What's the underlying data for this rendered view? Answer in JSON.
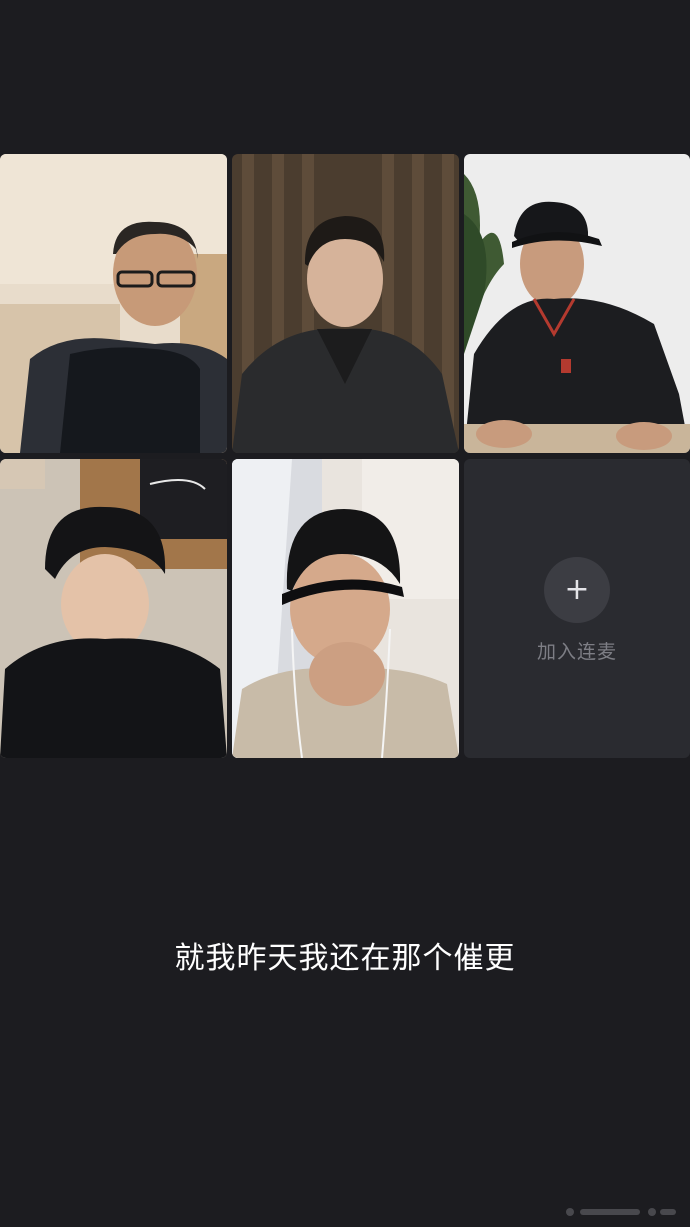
{
  "call": {
    "participants": [
      {
        "id": "participant-1",
        "description_icon": "video-feed"
      },
      {
        "id": "participant-2",
        "description_icon": "video-feed"
      },
      {
        "id": "participant-3",
        "description_icon": "video-feed"
      },
      {
        "id": "participant-4",
        "description_icon": "video-feed"
      },
      {
        "id": "participant-5",
        "description_icon": "video-feed"
      }
    ],
    "join_slot": {
      "icon": "plus-icon",
      "label": "加入连麦"
    }
  },
  "caption": {
    "text": "就我昨天我还在那个催更"
  },
  "colors": {
    "background": "#1c1c20",
    "empty_tile": "#2a2b30",
    "join_button": "#3c3d43",
    "join_label": "#7d7e85",
    "caption_text": "#ffffff"
  }
}
